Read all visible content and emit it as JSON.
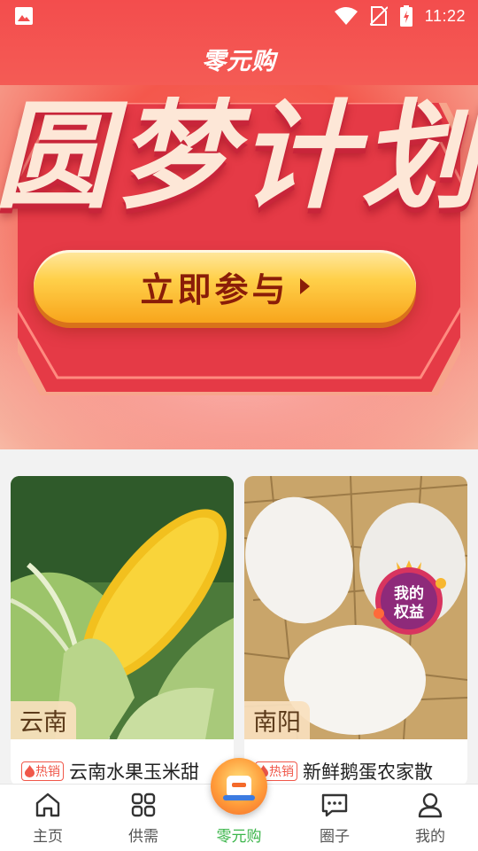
{
  "status_bar": {
    "time": "11:22",
    "icons": [
      "image-icon",
      "wifi-icon",
      "no-sim-icon",
      "battery-charging-icon"
    ]
  },
  "header": {
    "title": "零元购"
  },
  "banner": {
    "title": "圆梦计划",
    "cta_label": "立即参与"
  },
  "products": [
    {
      "region": "云南",
      "badge": "热销",
      "name": "云南水果玉米甜"
    },
    {
      "region": "南阳",
      "badge": "热销",
      "name": "新鲜鹅蛋农家散"
    }
  ],
  "floating_badge": {
    "label_line1": "我的",
    "label_line2": "权益"
  },
  "bottom_nav": {
    "items": [
      {
        "label": "主页",
        "icon": "home-icon",
        "active": false
      },
      {
        "label": "供需",
        "icon": "grid-icon",
        "active": false
      },
      {
        "label": "零元购",
        "icon": "zero-buy-icon",
        "active": true
      },
      {
        "label": "圈子",
        "icon": "chat-bubble-icon",
        "active": false
      },
      {
        "label": "我的",
        "icon": "user-icon",
        "active": false
      }
    ]
  },
  "colors": {
    "header_red": "#f34d4d",
    "active_green": "#3bb54a",
    "hot_red": "#f0584a",
    "cta_gold": "#ffd04a"
  }
}
